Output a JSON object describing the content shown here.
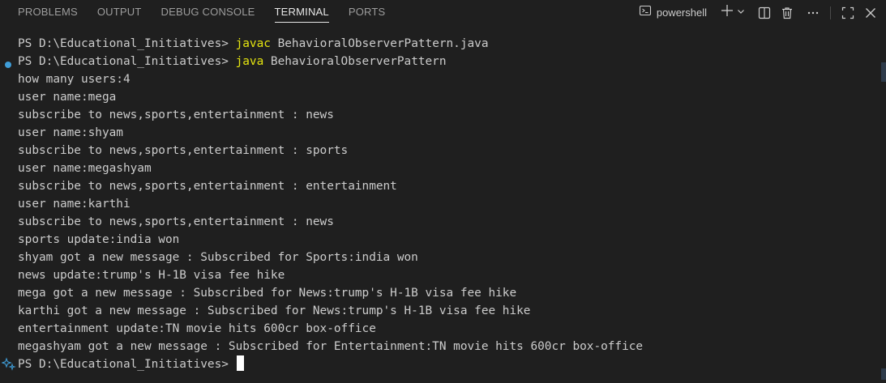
{
  "panel": {
    "tabs": [
      {
        "label": "PROBLEMS"
      },
      {
        "label": "OUTPUT"
      },
      {
        "label": "DEBUG CONSOLE"
      },
      {
        "label": "TERMINAL"
      },
      {
        "label": "PORTS"
      }
    ],
    "active_tab": "TERMINAL",
    "shell_label": "powershell"
  },
  "icons": {
    "shell": "terminal-icon",
    "add": "plus-icon",
    "dropdown": "chevron-down-icon",
    "split": "split-terminal-icon",
    "kill": "trash-icon",
    "more": "ellipsis-icon",
    "maximize": "maximize-panel-icon",
    "close": "close-icon"
  },
  "colors": {
    "background": "#1f1f1f",
    "text": "#cccccc",
    "command": "#e5e510",
    "decoration": "#3f9dd8"
  },
  "terminal": {
    "lines": [
      {
        "prompt": "PS D:\\Educational_Initiatives> ",
        "cmd": "javac",
        "rest": " BehavioralObserverPattern.java"
      },
      {
        "prompt": "PS D:\\Educational_Initiatives> ",
        "cmd": "java",
        "rest": " BehavioralObserverPattern"
      },
      {
        "text": "how many users:4"
      },
      {
        "text": "user name:mega"
      },
      {
        "text": "subscribe to news,sports,entertainment : news"
      },
      {
        "text": "user name:shyam"
      },
      {
        "text": "subscribe to news,sports,entertainment : sports"
      },
      {
        "text": "user name:megashyam"
      },
      {
        "text": "subscribe to news,sports,entertainment : entertainment"
      },
      {
        "text": "user name:karthi"
      },
      {
        "text": "subscribe to news,sports,entertainment : news"
      },
      {
        "text": "sports update:india won"
      },
      {
        "text": "shyam got a new message : Subscribed for Sports:india won"
      },
      {
        "text": "news update:trump's H-1B visa fee hike"
      },
      {
        "text": "mega got a new message : Subscribed for News:trump's H-1B visa fee hike"
      },
      {
        "text": "karthi got a new message : Subscribed for News:trump's H-1B visa fee hike"
      },
      {
        "text": "entertainment update:TN movie hits 600cr box-office"
      },
      {
        "text": "megashyam got a new message : Subscribed for Entertainment:TN movie hits 600cr box-office"
      },
      {
        "prompt": "PS D:\\Educational_Initiatives> "
      }
    ]
  }
}
